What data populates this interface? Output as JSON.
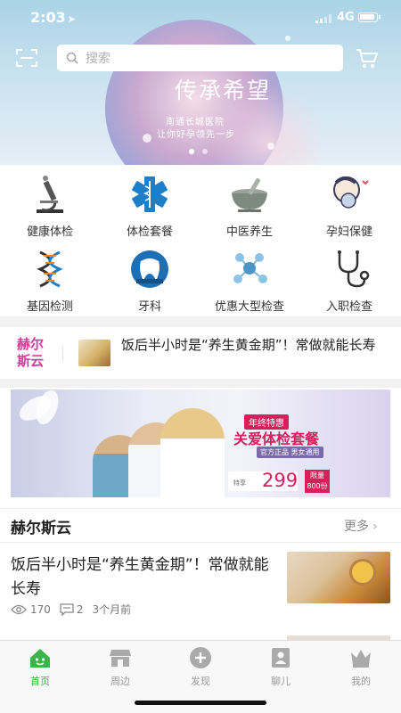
{
  "status_bar": {
    "time": "2:03",
    "network": "4G"
  },
  "search": {
    "placeholder": "搜索"
  },
  "banner": {
    "slogan": "传承希望",
    "line1": "南通长城医院",
    "line2": "让你好孕领先一步",
    "slide_count": 2,
    "active_slide": 0
  },
  "categories": [
    {
      "label": "健康体检",
      "icon": "microscope-icon"
    },
    {
      "label": "体检套餐",
      "icon": "medical-caduceus-icon"
    },
    {
      "label": "中医养生",
      "icon": "mortar-pestle-icon"
    },
    {
      "label": "孕妇保健",
      "icon": "pregnant-woman-icon"
    },
    {
      "label": "基因检测",
      "icon": "dna-icon"
    },
    {
      "label": "牙科",
      "icon": "tooth-icon"
    },
    {
      "label": "优惠大型检查",
      "icon": "molecule-icon"
    },
    {
      "label": "入职检查",
      "icon": "stethoscope-icon"
    }
  ],
  "ticker": {
    "brand": "赫尔斯云",
    "headline": "饭后半小时是“养生黄金期”！常做就能长寿"
  },
  "promo": {
    "badge": "年终特惠",
    "title": "关爱体检套餐",
    "tagline": "官方正品 男女通用",
    "price_prefix": "特享",
    "price": "299",
    "limit": "限量 800份"
  },
  "section": {
    "title": "赫尔斯云",
    "more": "更多"
  },
  "article": {
    "title": "饭后半小时是“养生黄金期”！常做就能长寿",
    "views": "170",
    "comments": "2",
    "time_ago": "3个月前"
  },
  "tabs": [
    {
      "label": "首页",
      "icon": "home-icon",
      "active": true
    },
    {
      "label": "周边",
      "icon": "store-icon",
      "active": false
    },
    {
      "label": "发现",
      "icon": "plus-circle-icon",
      "active": false
    },
    {
      "label": "聊儿",
      "icon": "contact-card-icon",
      "active": false
    },
    {
      "label": "我的",
      "icon": "crown-icon",
      "active": false
    }
  ],
  "colors": {
    "accent_green": "#3bb54a",
    "brand_pink": "#d63a9a",
    "promo_red": "#d81e5b"
  }
}
